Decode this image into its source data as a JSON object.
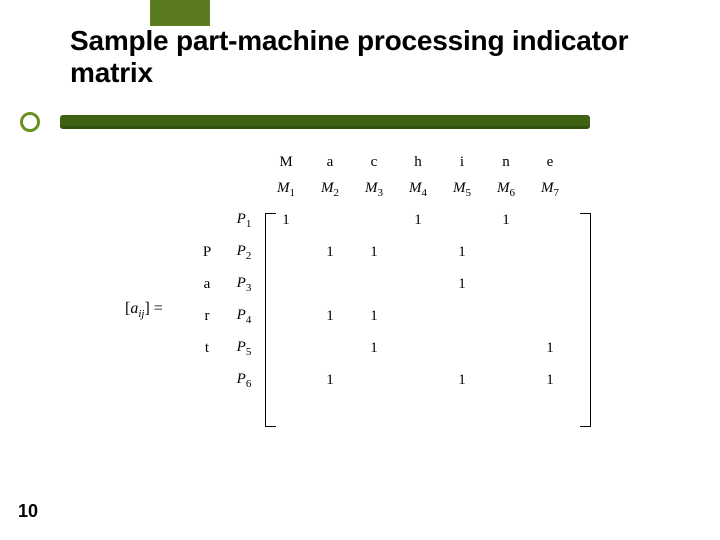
{
  "slide": {
    "title": "Sample part-machine processing indicator matrix",
    "page_number": "10"
  },
  "matrix": {
    "lhs": "[a_{ij}] =",
    "top_word": [
      "",
      "",
      "M",
      "a",
      "c",
      "h",
      "i",
      "n",
      "e"
    ],
    "side_word": [
      "",
      "",
      "P",
      "a",
      "r",
      "t",
      ""
    ],
    "col_labels": [
      "M1",
      "M2",
      "M3",
      "M4",
      "M5",
      "M6",
      "M7"
    ],
    "row_labels": [
      "P1",
      "P2",
      "P3",
      "P4",
      "P5",
      "P6"
    ],
    "cells": [
      [
        "1",
        "",
        "",
        "1",
        "",
        "1",
        ""
      ],
      [
        "",
        "1",
        "1",
        "",
        "1",
        "",
        ""
      ],
      [
        "",
        "",
        "",
        "",
        "1",
        "",
        ""
      ],
      [
        "",
        "1",
        "1",
        "",
        "",
        "",
        ""
      ],
      [
        "",
        "",
        "1",
        "",
        "",
        "",
        "1"
      ],
      [
        "",
        "1",
        "",
        "",
        "1",
        "",
        "1"
      ]
    ]
  },
  "chart_data": {
    "type": "table",
    "title": "Sample part-machine processing indicator matrix",
    "row_labels": [
      "P1",
      "P2",
      "P3",
      "P4",
      "P5",
      "P6"
    ],
    "col_labels": [
      "M1",
      "M2",
      "M3",
      "M4",
      "M5",
      "M6",
      "M7"
    ],
    "values": [
      [
        1,
        0,
        0,
        1,
        0,
        1,
        0
      ],
      [
        0,
        1,
        1,
        0,
        1,
        0,
        0
      ],
      [
        0,
        0,
        0,
        0,
        1,
        0,
        0
      ],
      [
        0,
        1,
        1,
        0,
        0,
        0,
        0
      ],
      [
        0,
        0,
        1,
        0,
        0,
        0,
        1
      ],
      [
        0,
        1,
        0,
        0,
        1,
        0,
        1
      ]
    ],
    "notation": "[a_ij]"
  }
}
